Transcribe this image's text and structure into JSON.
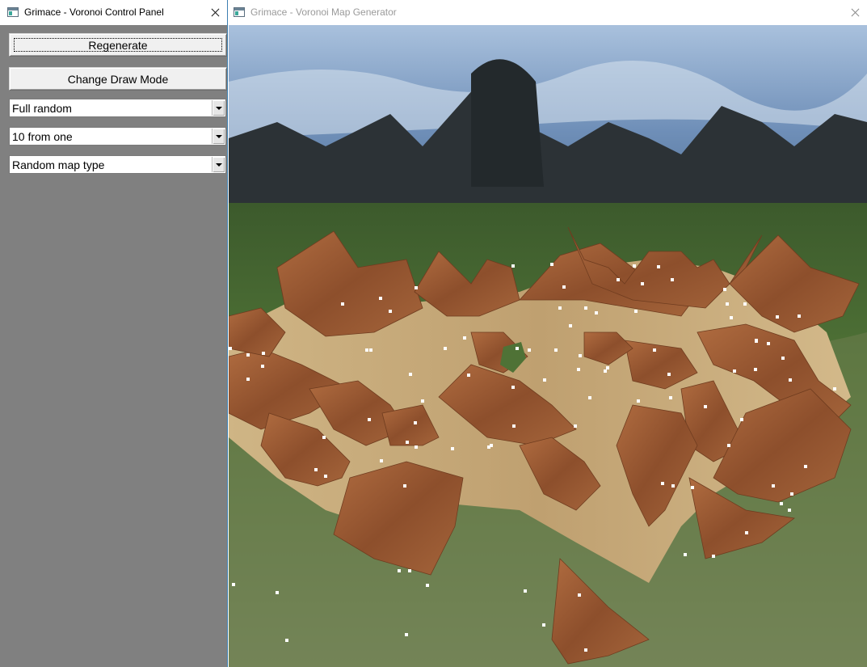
{
  "control_panel": {
    "title": "Grimace - Voronoi Control Panel",
    "regenerate_label": "Regenerate",
    "draw_mode_label": "Change Draw Mode",
    "selectors": [
      {
        "value": "Full random"
      },
      {
        "value": "10 from one"
      },
      {
        "value": "Random map type"
      }
    ]
  },
  "map_window": {
    "title": "Grimace - Voronoi Map Generator"
  },
  "icons": {
    "window_icon": "app-window-icon",
    "close": "close-icon",
    "dropdown": "chevron-down-icon"
  },
  "colors": {
    "panel_bg": "#808080",
    "sky": "#6f8fb8",
    "grass": "#4c6f34",
    "tree": "#2a2f33",
    "cell_wood": "#9a5a34",
    "cell_sand": "#c9ad7b",
    "site_marker": "#ffffff"
  }
}
